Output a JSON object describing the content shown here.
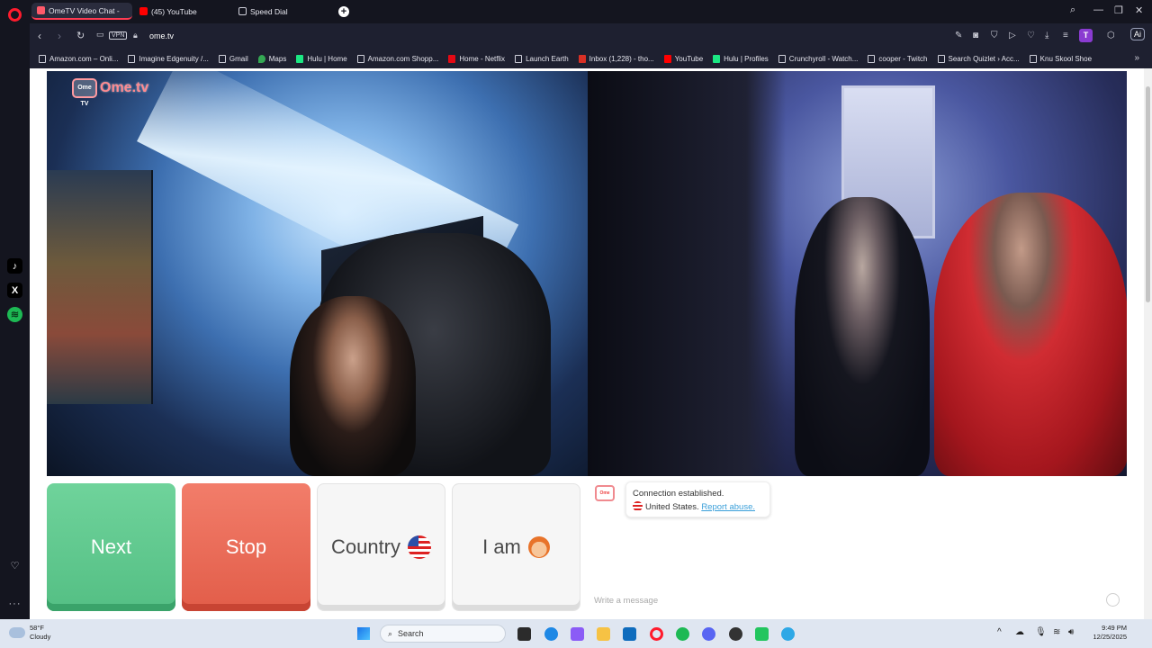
{
  "browser": {
    "tabs": [
      {
        "label": "OmeTV Video Chat -",
        "active": true,
        "icon": "ome-tv-icon"
      },
      {
        "label": "(45) YouTube",
        "active": false,
        "icon": "youtube-icon"
      },
      {
        "label": "Speed Dial",
        "active": false,
        "icon": "grid-icon"
      }
    ],
    "url": "ome.tv",
    "vpn_label": "VPN",
    "profile_initial": "T",
    "ai_label": "Ai"
  },
  "bookmarks": [
    {
      "label": "Amazon.com – Onli...",
      "icon": "page-icon"
    },
    {
      "label": "Imagine Edgenuity /...",
      "icon": "page-icon"
    },
    {
      "label": "Gmail",
      "icon": "page-icon"
    },
    {
      "label": "Maps",
      "icon": "maps-icon"
    },
    {
      "label": "Hulu | Home",
      "icon": "hulu-icon"
    },
    {
      "label": "Amazon.com Shopp...",
      "icon": "page-icon"
    },
    {
      "label": "Home - Netflix",
      "icon": "netflix-icon"
    },
    {
      "label": "Launch Earth",
      "icon": "page-icon"
    },
    {
      "label": "Inbox (1,228) - tho...",
      "icon": "gmail-icon"
    },
    {
      "label": "YouTube",
      "icon": "youtube-icon"
    },
    {
      "label": "Hulu | Profiles",
      "icon": "hulu-icon"
    },
    {
      "label": "Crunchyroll - Watch...",
      "icon": "page-icon"
    },
    {
      "label": "cooper - Twitch",
      "icon": "page-icon"
    },
    {
      "label": "Search Quizlet › Acc...",
      "icon": "page-icon"
    },
    {
      "label": "Knu Skool Shoe",
      "icon": "page-icon"
    }
  ],
  "ometv": {
    "logo_text": "Ome.tv",
    "logo_icon_text": "Ome TV",
    "buttons": {
      "next": "Next",
      "stop": "Stop",
      "country": "Country",
      "iam": "I am"
    },
    "chat": {
      "status": "Connection established.",
      "country": "United States.",
      "report": "Report abuse.",
      "placeholder": "Write a message"
    }
  },
  "taskbar": {
    "weather_temp": "58°F",
    "weather_desc": "Cloudy",
    "search_placeholder": "Search",
    "time": "9:49 PM",
    "date": "12/25/2025"
  },
  "colors": {
    "next": "#54bf84",
    "stop": "#e25d49",
    "opera_red": "#ff1b2d"
  }
}
